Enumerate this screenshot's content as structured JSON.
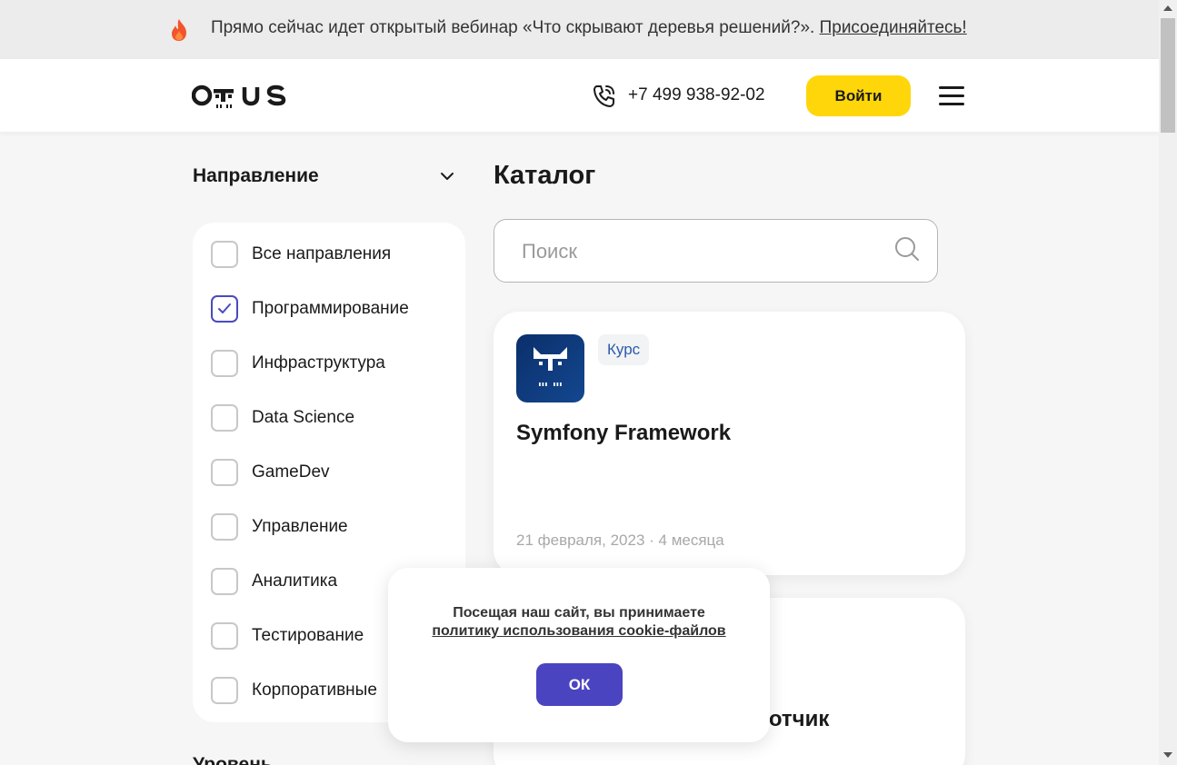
{
  "banner": {
    "text": "Прямо сейчас идет открытый вебинар «Что скрывают деревья решений?». ",
    "link": "Присоединяйтесь!",
    "icon": "fire-icon"
  },
  "header": {
    "logo_text": "otus",
    "phone": "+7 499 938-92-02",
    "login_label": "Войти",
    "accent_color": "#ffd60a"
  },
  "filters": {
    "title": "Направление",
    "items": [
      {
        "label": "Все направления",
        "checked": false
      },
      {
        "label": "Программирование",
        "checked": true
      },
      {
        "label": "Инфраструктура",
        "checked": false
      },
      {
        "label": "Data Science",
        "checked": false
      },
      {
        "label": "GameDev",
        "checked": false
      },
      {
        "label": "Управление",
        "checked": false
      },
      {
        "label": "Аналитика",
        "checked": false
      },
      {
        "label": "Тестирование",
        "checked": false
      },
      {
        "label": "Корпоративные",
        "checked": false
      }
    ],
    "level_title": "Уровень"
  },
  "catalog": {
    "title": "Каталог",
    "search_placeholder": "Поиск",
    "cards": [
      {
        "tag": "Курс",
        "title": "Symfony Framework",
        "meta": "21 февраля, 2023 · 4 месяца"
      },
      {
        "title": "ботчик"
      }
    ]
  },
  "cookie": {
    "line1": "Посещая наш сайт, вы принимаете",
    "link": "политику использования cookie-файлов",
    "ok_label": "ОК",
    "button_color": "#4b44c1"
  }
}
